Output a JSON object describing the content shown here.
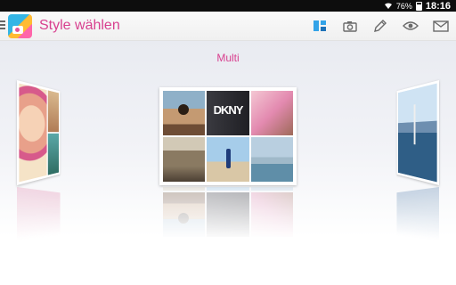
{
  "status_bar": {
    "battery": "76%",
    "time": "18:16"
  },
  "action_bar": {
    "title": "Style wählen",
    "title_color": "#d8408f",
    "actions": [
      {
        "icon": "layout-icon",
        "color": "#33a3e8"
      },
      {
        "icon": "camera-icon",
        "color": "#6a6a6a"
      },
      {
        "icon": "pencil-icon",
        "color": "#6a6a6a"
      },
      {
        "icon": "eye-icon",
        "color": "#6a6a6a"
      },
      {
        "icon": "mail-icon",
        "color": "#6a6a6a"
      }
    ]
  },
  "carousel": {
    "current_style": "Multi",
    "center_overlay_text": "DKNY"
  }
}
